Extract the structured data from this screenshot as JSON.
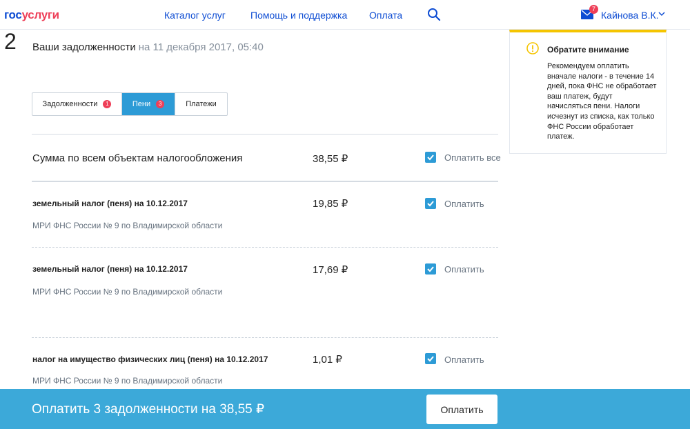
{
  "header": {
    "logo_part1": "гос",
    "logo_part2": "услуги",
    "nav": [
      "Каталог услуг",
      "Помощь и поддержка",
      "Оплата"
    ],
    "mail_count": "7",
    "user_name": "Кайнова В.К."
  },
  "step": {
    "number": "2",
    "title": "Ваши задолженности",
    "date": "на 11 декабря 2017, 05:40"
  },
  "tabs": [
    {
      "label": "Задолженности",
      "badge": "1"
    },
    {
      "label": "Пени",
      "badge": "3",
      "active": true
    },
    {
      "label": "Платежи"
    }
  ],
  "summary": {
    "title": "Сумма по всем объектам налогообложения",
    "amount": "38,55 ₽",
    "checkbox_label": "Оплатить все",
    "checked": true
  },
  "items": [
    {
      "title": "земельный налог (пеня) на 10.12.2017",
      "amount": "19,85 ₽",
      "org": "МРИ ФНС России № 9 по Владимирской области",
      "checkbox_label": "Оплатить",
      "checked": true
    },
    {
      "title": "земельный налог (пеня) на 10.12.2017",
      "amount": "17,69 ₽",
      "org": "МРИ ФНС России № 9 по Владимирской области",
      "checkbox_label": "Оплатить",
      "checked": true
    },
    {
      "title": "налог на имущество физических лиц (пеня) на 10.12.2017",
      "amount": "1,01 ₽",
      "org": "МРИ ФНС России № 9 по Владимирской области",
      "checkbox_label": "Оплатить",
      "checked": true
    }
  ],
  "notice": {
    "title": "Обратите внимание",
    "text": "Рекомендуем оплатить вначале налоги - в течение 14 дней, пока ФНС не обработает ваш платеж, будут начисляться пени. Налоги исчезнут из списка, как только ФНС России обработает платеж."
  },
  "footer": {
    "text": "Оплатить 3 задолженности на 38,55 ₽",
    "button": "Оплатить"
  },
  "colors": {
    "accent": "#2d9bd6",
    "footer_bg": "#3ca9d9",
    "link": "#0d4cd3",
    "badge": "#ee3f58",
    "notice_border": "#f5c500"
  }
}
